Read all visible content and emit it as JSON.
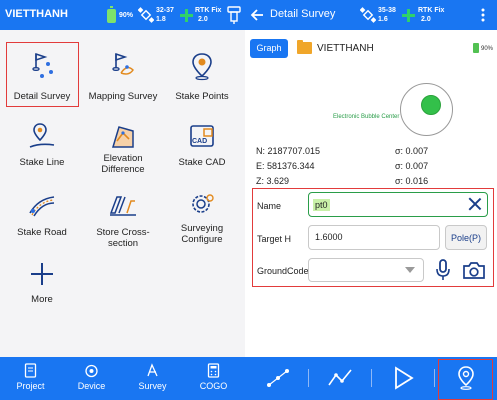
{
  "left": {
    "statusbar": {
      "title": "VIETTHANH",
      "battery": "90%",
      "sat_top": "32-37",
      "sat_bottom": "1.8",
      "rtk_label": "RTK Fix",
      "rtk_value": "2.0"
    },
    "grid": [
      {
        "label": "Detail Survey",
        "icon": "flags-points-icon"
      },
      {
        "label": "Mapping Survey",
        "icon": "flag-line-icon"
      },
      {
        "label": "Stake Points",
        "icon": "map-pin-icon"
      },
      {
        "label": "Stake Line",
        "icon": "pin-line-icon"
      },
      {
        "label": "Elevation Difference",
        "icon": "elevation-icon"
      },
      {
        "label": "Stake CAD",
        "icon": "cad-icon"
      },
      {
        "label": "Stake Road",
        "icon": "road-icon"
      },
      {
        "label": "Store Cross-section",
        "icon": "cross-section-icon"
      },
      {
        "label": "Surveying Configure",
        "icon": "gear-icon"
      },
      {
        "label": "More",
        "icon": "plus-icon"
      }
    ],
    "bottom_nav": [
      {
        "label": "Project",
        "icon": "document-icon"
      },
      {
        "label": "Device",
        "icon": "device-icon"
      },
      {
        "label": "Survey",
        "icon": "survey-icon"
      },
      {
        "label": "COGO",
        "icon": "calculator-icon"
      }
    ]
  },
  "right": {
    "header": {
      "title": "Detail Survey",
      "sat_top": "35-38",
      "sat_bottom": "1.6",
      "rtk_label": "RTK Fix",
      "rtk_value": "2.0"
    },
    "graph_button": "Graph",
    "project_name": "VIETTHANH",
    "battery": "90%",
    "bubble_label": "Electronic Bubble Center",
    "coords": {
      "n": "N: 2187707.015",
      "e": "E: 581376.344",
      "z": "Z: 3.629",
      "sigma_n": "σ: 0.007",
      "sigma_e": "σ: 0.007",
      "sigma_z": "σ: 0.016"
    },
    "form": {
      "name_label": "Name",
      "name_value": "pt0",
      "target_label": "Target H",
      "target_value": "1.6000",
      "pole_button": "Pole(P)",
      "code_label": "GroundCode",
      "code_value": ""
    },
    "toolbar": [
      "line-points-icon",
      "polyline-icon",
      "play-icon",
      "pin-icon"
    ]
  },
  "colors": {
    "primary": "#1976f2",
    "highlight": "#e23b3b",
    "accent_green": "#2a9d49"
  }
}
